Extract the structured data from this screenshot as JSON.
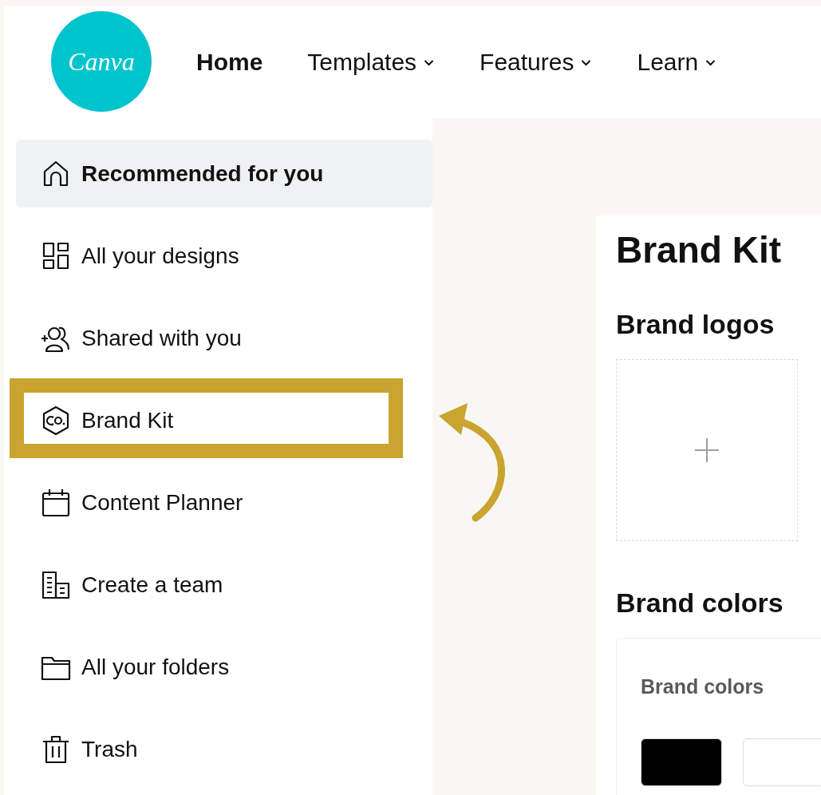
{
  "logo": {
    "text": "Canva"
  },
  "nav": [
    {
      "label": "Home",
      "selected": true,
      "dropdown": false
    },
    {
      "label": "Templates",
      "selected": false,
      "dropdown": true
    },
    {
      "label": "Features",
      "selected": false,
      "dropdown": true
    },
    {
      "label": "Learn",
      "selected": false,
      "dropdown": true
    }
  ],
  "sidebar": {
    "items": [
      {
        "label": "Recommended for you",
        "selected": true,
        "highlighted": false
      },
      {
        "label": "All your designs",
        "selected": false,
        "highlighted": false
      },
      {
        "label": "Shared with you",
        "selected": false,
        "highlighted": false
      },
      {
        "label": "Brand Kit",
        "selected": false,
        "highlighted": true
      },
      {
        "label": "Content Planner",
        "selected": false,
        "highlighted": false
      },
      {
        "label": "Create a team",
        "selected": false,
        "highlighted": false
      },
      {
        "label": "All your folders",
        "selected": false,
        "highlighted": false
      },
      {
        "label": "Trash",
        "selected": false,
        "highlighted": false
      }
    ]
  },
  "brand_kit": {
    "title": "Brand Kit",
    "logos_heading": "Brand logos",
    "colors_heading": "Brand colors",
    "colors_card": {
      "title": "Brand colors",
      "swatches": [
        {
          "color": "#000000"
        },
        {
          "color": "#ffffff"
        }
      ]
    }
  }
}
